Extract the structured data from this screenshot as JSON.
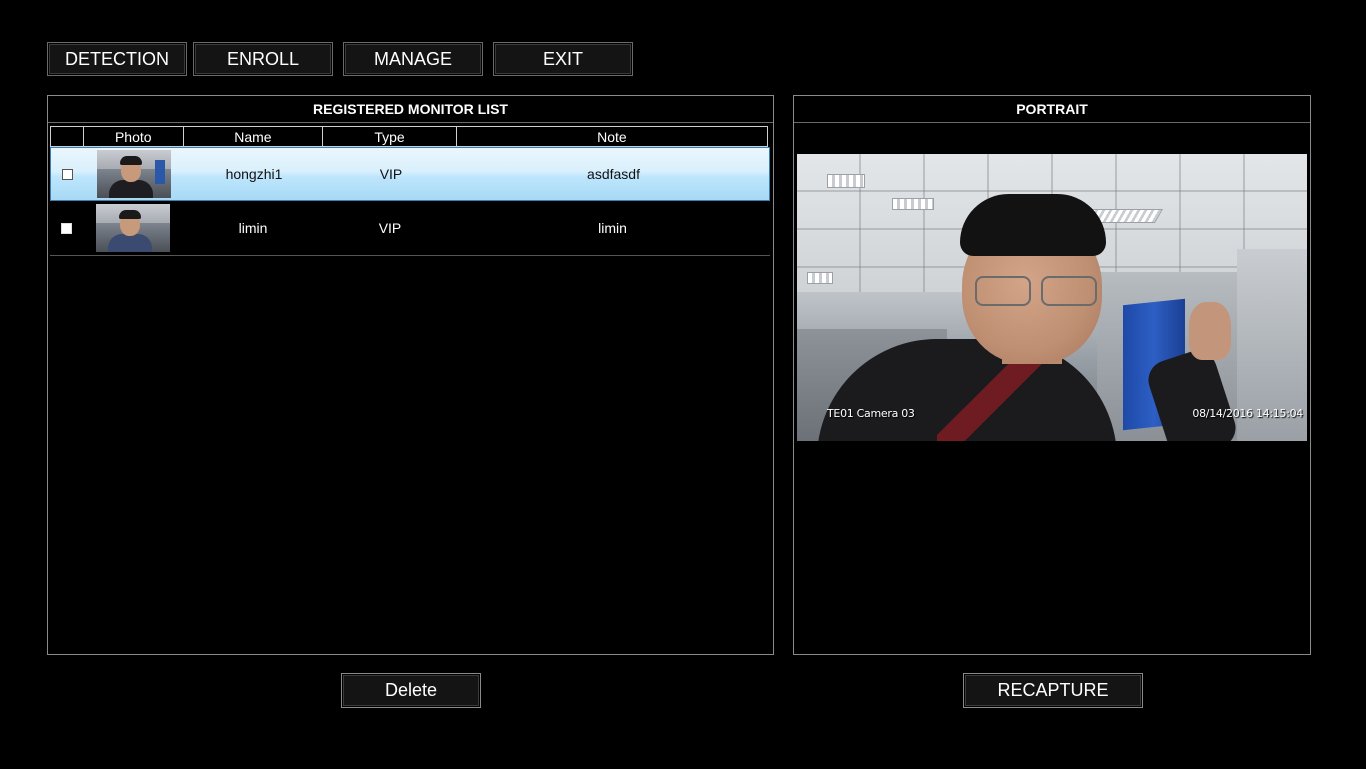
{
  "nav": {
    "detection": "DETECTION",
    "enroll": "ENROLL",
    "manage": "MANAGE",
    "exit": "EXIT"
  },
  "list_panel": {
    "title": "REGISTERED MONITOR LIST",
    "columns": [
      "",
      "Photo",
      "Name",
      "Type",
      "Note"
    ],
    "rows": [
      {
        "name": "hongzhi1",
        "type": "VIP",
        "note": "asdfasdf",
        "selected": true,
        "checked": false
      },
      {
        "name": "limin",
        "type": "VIP",
        "note": "limin",
        "selected": false,
        "checked": false
      }
    ]
  },
  "portrait_panel": {
    "title": "PORTRAIT",
    "camera_label": "TE01  Camera 03",
    "timestamp": "08/14/2016   14:15:04"
  },
  "actions": {
    "delete": "Delete",
    "recapture": "RECAPTURE"
  },
  "colors": {
    "background": "#000000",
    "selected_row_top": "#eaf6fd",
    "selected_row_bottom": "#a7d9f5",
    "selected_row_border": "#3c7fb1",
    "border": "#8a8a8a"
  }
}
